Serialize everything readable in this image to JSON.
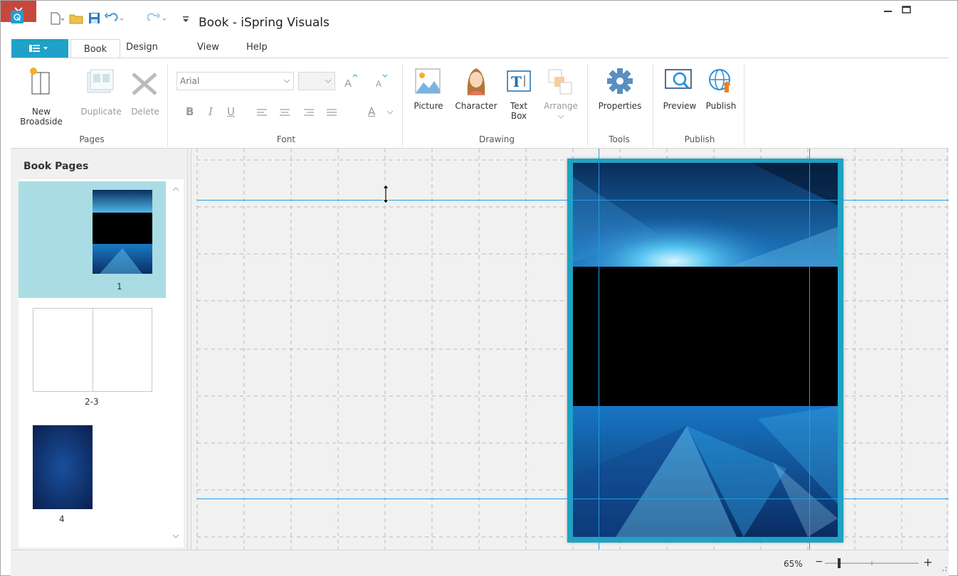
{
  "window": {
    "title": "Book - iSpring Visuals"
  },
  "tabs": {
    "book": "Book",
    "design": "Design",
    "view": "View",
    "help": "Help"
  },
  "ribbon": {
    "pages": {
      "group_label": "Pages",
      "new_broadside": [
        "New",
        "Broadside"
      ],
      "duplicate": "Duplicate",
      "delete": "Delete"
    },
    "font": {
      "group_label": "Font",
      "font_name": "Arial",
      "font_size": "",
      "bold": "B",
      "italic": "I",
      "underline": "U",
      "font_color": "A"
    },
    "drawing": {
      "group_label": "Drawing",
      "picture": "Picture",
      "character": "Character",
      "text_box": [
        "Text",
        "Box"
      ],
      "arrange": "Arrange"
    },
    "tools": {
      "group_label": "Tools",
      "properties": "Properties"
    },
    "publish": {
      "group_label": "Publish",
      "preview": "Preview",
      "publish": "Publish"
    }
  },
  "left_panel": {
    "title": "Book Pages",
    "pages": [
      {
        "label": "1",
        "selected": true
      },
      {
        "label": "2-3",
        "selected": false
      },
      {
        "label": "4",
        "selected": false
      }
    ]
  },
  "statusbar": {
    "zoom": "65%",
    "zoom_out": "−",
    "zoom_in": "+"
  },
  "colors": {
    "accent": "#1fa1c8",
    "selected_page": "#a9dde3",
    "close_button": "#c7473c",
    "guide_line": "#1e9fe0"
  }
}
